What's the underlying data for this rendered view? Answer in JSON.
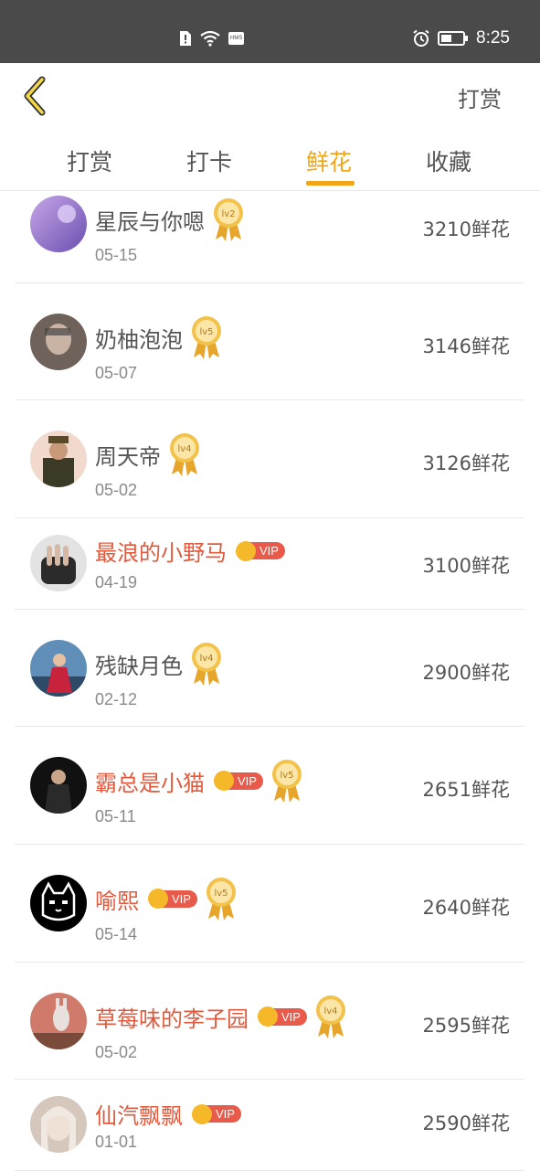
{
  "status_bar": {
    "time": "8:25",
    "hms_label": "HMS"
  },
  "header": {
    "back_icon": "chevron-left-icon",
    "right_action": "打赏",
    "accent_color": "#f2a516"
  },
  "tabs": [
    {
      "label": "打赏",
      "active": false
    },
    {
      "label": "打卡",
      "active": false
    },
    {
      "label": "鲜花",
      "active": true
    },
    {
      "label": "收藏",
      "active": false
    }
  ],
  "rows": [
    {
      "name": "星辰与你嗯",
      "date": "05-15",
      "amount": "3210鲜花",
      "vip": false,
      "level": "lv2"
    },
    {
      "name": "奶柚泡泡",
      "date": "05-07",
      "amount": "3146鲜花",
      "vip": false,
      "level": "lv5"
    },
    {
      "name": "周天帝",
      "date": "05-02",
      "amount": "3126鲜花",
      "vip": false,
      "level": "lv4"
    },
    {
      "name": "最浪的小野马",
      "date": "04-19",
      "amount": "3100鲜花",
      "vip": true,
      "vip_label": "VIP",
      "level": ""
    },
    {
      "name": "残缺月色",
      "date": "02-12",
      "amount": "2900鲜花",
      "vip": false,
      "level": "lv4"
    },
    {
      "name": "霸总是小猫",
      "date": "05-11",
      "amount": "2651鲜花",
      "vip": true,
      "vip_label": "VIP",
      "level": "lv5"
    },
    {
      "name": "喻熙",
      "date": "05-14",
      "amount": "2640鲜花",
      "vip": true,
      "vip_label": "VIP",
      "level": "lv5"
    },
    {
      "name": "草莓味的李子园",
      "date": "05-02",
      "amount": "2595鲜花",
      "vip": true,
      "vip_label": "VIP",
      "level": "lv4"
    },
    {
      "name": "仙汽飘飘",
      "date": "01-01",
      "amount": "2590鲜花",
      "vip": true,
      "vip_label": "VIP",
      "level": ""
    }
  ]
}
